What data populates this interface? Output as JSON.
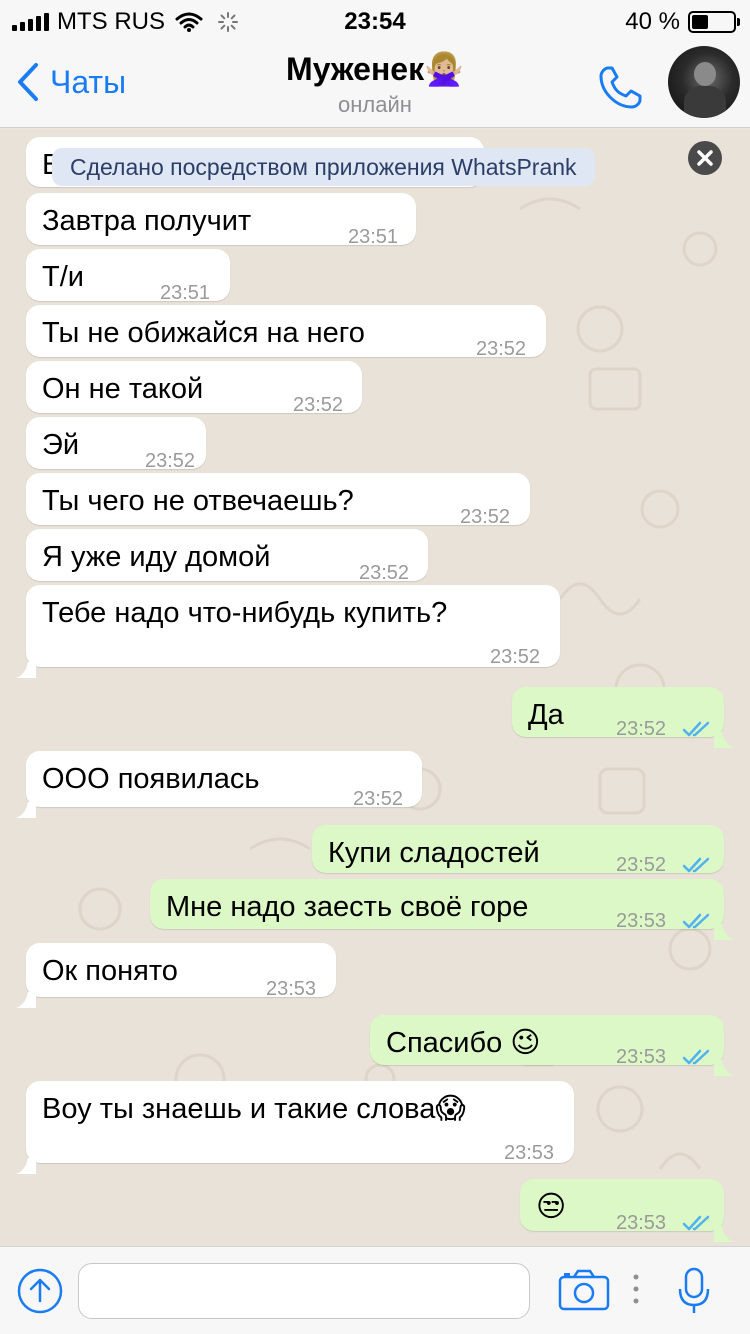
{
  "status_bar": {
    "carrier": "MTS RUS",
    "time": "23:54",
    "battery_percent": "40 %",
    "battery_level": 0.4
  },
  "header": {
    "back_label": "Чаты",
    "contact_name": "Муженек🙅🏼‍♀️",
    "status": "онлайн"
  },
  "banner": {
    "text": "Сделано посредством приложения WhatsPrank"
  },
  "messages": [
    {
      "dir": "in",
      "text": "В",
      "time": ""
    },
    {
      "dir": "in",
      "text": "Завтра получит",
      "time": "23:51"
    },
    {
      "dir": "in",
      "text": "Т/и",
      "time": "23:51"
    },
    {
      "dir": "in",
      "text": "Ты не обижайся на него",
      "time": "23:52"
    },
    {
      "dir": "in",
      "text": "Он не такой",
      "time": "23:52"
    },
    {
      "dir": "in",
      "text": "Эй",
      "time": "23:52"
    },
    {
      "dir": "in",
      "text": "Ты чего не отвечаешь?",
      "time": "23:52"
    },
    {
      "dir": "in",
      "text": "Я уже иду домой",
      "time": "23:52"
    },
    {
      "dir": "in",
      "text": "Тебе надо что-нибудь купить?",
      "time": "23:52"
    },
    {
      "dir": "out",
      "text": "Да",
      "time": "23:52"
    },
    {
      "dir": "in",
      "text": "ООО появилась",
      "time": "23:52"
    },
    {
      "dir": "out",
      "text": "Купи сладостей",
      "time": "23:52"
    },
    {
      "dir": "out",
      "text": "Мне надо заесть своё горе",
      "time": "23:53"
    },
    {
      "dir": "in",
      "text": "Ок понято",
      "time": "23:53"
    },
    {
      "dir": "out",
      "text": "Спасибо 😉",
      "time": "23:53"
    },
    {
      "dir": "in",
      "text": "Воу ты знаешь и такие слова😱",
      "time": "23:53"
    },
    {
      "dir": "out",
      "text": "😒",
      "time": "23:53"
    }
  ],
  "input": {
    "value": "",
    "placeholder": ""
  },
  "colors": {
    "accent": "#1a7cf5",
    "outgoing_bubble": "#dcf8c6",
    "incoming_bubble": "#ffffff",
    "read_ticks": "#4fb3f0",
    "chat_background": "#e9e2d8"
  },
  "icons": [
    "signal-icon",
    "wifi-icon",
    "spinner-icon",
    "battery-icon",
    "back-chevron-icon",
    "phone-icon",
    "close-icon",
    "double-check-icon",
    "plus-upload-icon",
    "camera-icon",
    "microphone-icon"
  ]
}
